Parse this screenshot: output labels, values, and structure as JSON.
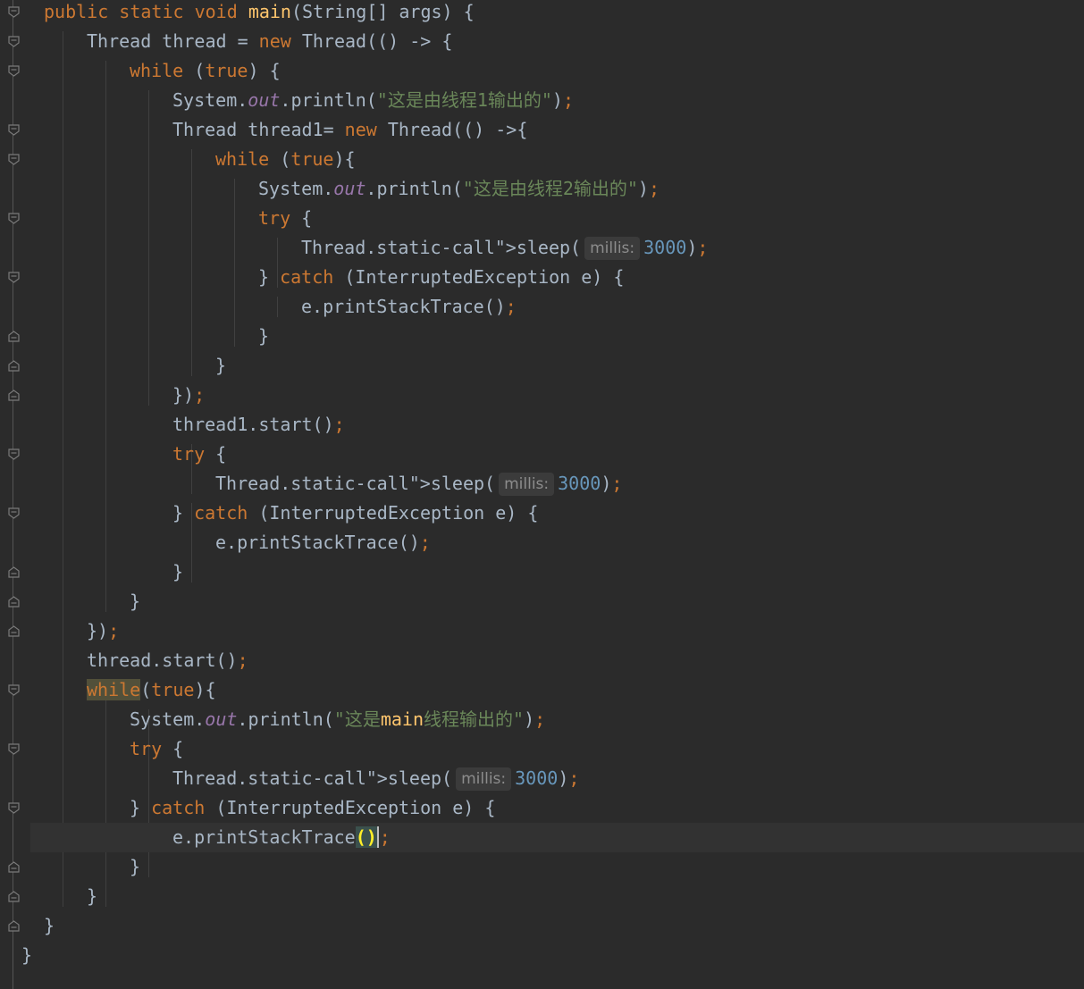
{
  "editor": {
    "lines": [
      "public static void main(String[] args) {",
      "Thread thread = new Thread(() -> {",
      "while (true) {",
      "System.out.println(\"这是由线程1输出的\");",
      "Thread thread1= new Thread(() ->{",
      "while (true){",
      "System.out.println(\"这是由线程2输出的\");",
      "try {",
      "Thread.sleep( millis: 3000);",
      "} catch (InterruptedException e) {",
      "e.printStackTrace();",
      "}",
      "}",
      "});",
      "thread1.start();",
      "try {",
      "Thread.sleep( millis: 3000);",
      "} catch (InterruptedException e) {",
      "e.printStackTrace();",
      "}",
      "}",
      "});",
      "thread.start();",
      "while(true){",
      "System.out.println(\"这是main线程输出的\");",
      "try {",
      "Thread.sleep( millis: 3000);",
      "} catch (InterruptedException e) {",
      "e.printStackTrace();",
      "}",
      "}",
      "}",
      "}"
    ],
    "hint_label": "millis:",
    "colors": {
      "background": "#2b2b2b",
      "keyword": "#cc7832",
      "string": "#6a8759",
      "number": "#6897bb",
      "field": "#9876aa",
      "method_decl": "#ffc66d",
      "text": "#a9b7c6"
    }
  }
}
